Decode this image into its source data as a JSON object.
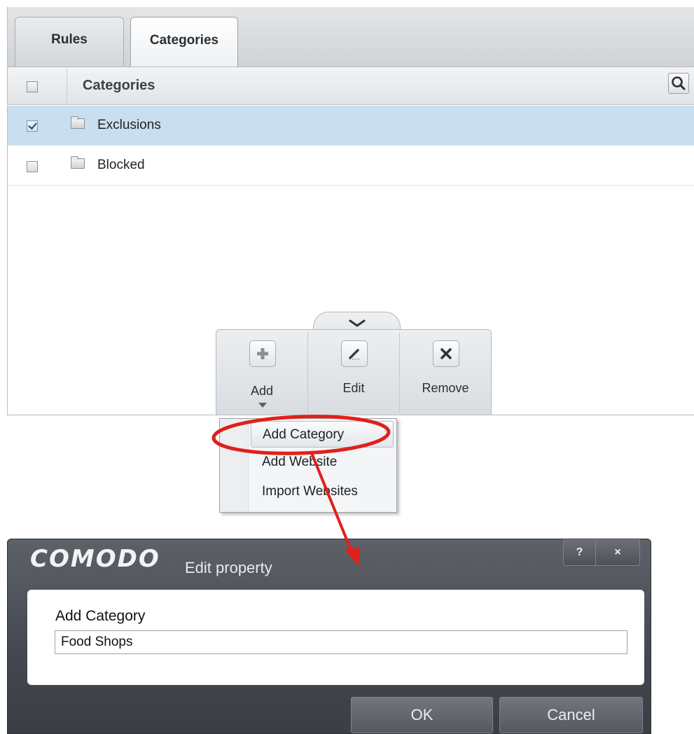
{
  "tabs": [
    {
      "label": "Rules",
      "active": false
    },
    {
      "label": "Categories",
      "active": true
    }
  ],
  "table": {
    "header": {
      "label": "Categories",
      "checked": false
    },
    "rows": [
      {
        "label": "Exclusions",
        "checked": true,
        "selected": true
      },
      {
        "label": "Blocked",
        "checked": false,
        "selected": false
      }
    ]
  },
  "toolbar": {
    "add_label": "Add",
    "edit_label": "Edit",
    "remove_label": "Remove"
  },
  "add_menu": {
    "items": [
      "Add Category",
      "Add Website",
      "Import Websites"
    ],
    "highlighted": "Add Category"
  },
  "dialog": {
    "brand": "COMODO",
    "title": "Edit property",
    "help_label": "?",
    "close_label": "×",
    "field_label": "Add Category",
    "field_value": "Food Shops",
    "ok_label": "OK",
    "cancel_label": "Cancel"
  },
  "colors": {
    "selected_row": "#c9dfef",
    "annotation_red": "#e0201b",
    "dialog_frame": "#44484e"
  },
  "icons": [
    "search-icon",
    "folder-icon",
    "chevron-down-icon",
    "plus-icon",
    "pencil-icon",
    "x-icon",
    "caret-down-icon",
    "help-icon",
    "close-icon"
  ]
}
